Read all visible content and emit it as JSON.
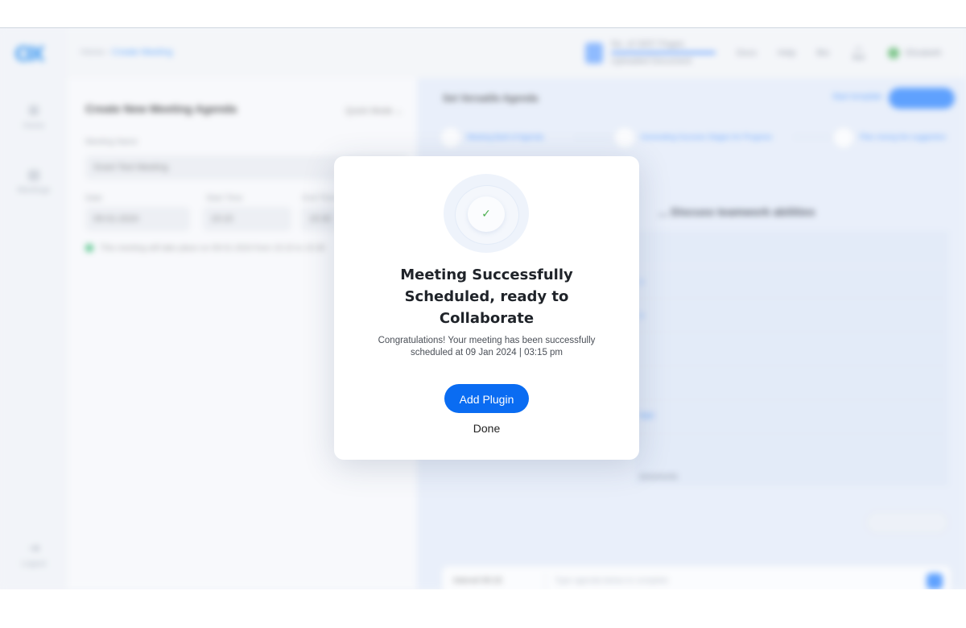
{
  "background": {
    "sidebar": {
      "logo": "OX",
      "items": [
        {
          "label": "Home",
          "icon": "home-icon"
        },
        {
          "label": "Meetings",
          "icon": "calendar-icon"
        },
        {
          "label": "Logout",
          "icon": "logout-icon"
        }
      ]
    },
    "topbar": {
      "breadcrumb": {
        "root": "Home",
        "current": "Create Meeting"
      },
      "doc_title": "No. of 3057 Pages",
      "doc_sub": "Uploaded Document",
      "links": [
        "Docs",
        "Help",
        "Bio"
      ],
      "user": "Elizabeth"
    },
    "left_panel": {
      "title": "Create New Meeting Agenda",
      "dropdown": "Quick Mode",
      "meeting_name_label": "Meeting Name",
      "meeting_name_value": "Grant Test Meeting",
      "date_label": "Date",
      "date_value": "09-01-2024",
      "start_label": "Start Time",
      "start_value": "15:15",
      "end_label": "End Time",
      "end_value": "15:30",
      "note": "This meeting will take place on 09-01-2024 from 15:15 to 15:30"
    },
    "right_panel": {
      "header": "Set Versatile Agenda",
      "link": "Start template",
      "steps": [
        "Meeting Built of Agenda",
        "Generating Success Stages for Progress",
        "Plan mixing the suggestion"
      ],
      "title": "... Discuss teamwork abilities",
      "bottom_select": "Intervel 00:15",
      "bottom_placeholder": "Type agenda below to complete"
    }
  },
  "modal": {
    "title_line1": "Meeting Successfully",
    "title_line2": "Scheduled, ready to",
    "title_line3": "Collaborate",
    "desc_line1": "Congratulations! Your meeting has been successfully",
    "desc_line2": "scheduled at 09 Jan 2024 | 03:15 pm",
    "primary_button": "Add Plugin",
    "secondary_button": "Done",
    "accent_color": "#0a6cf2",
    "check_color": "#4caf50"
  }
}
